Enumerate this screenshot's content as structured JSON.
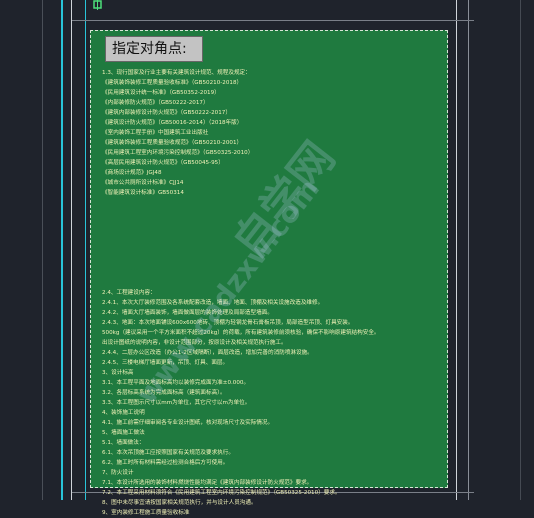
{
  "prompt": {
    "label": "指定对角点:"
  },
  "watermark": {
    "cn": "自学网",
    "url": "www.cadzxw.com"
  },
  "colors": {
    "background": "#1f232c",
    "selection_fill": "#1f7a3f",
    "text": "#f2f2b8",
    "prompt_bg": "#c3c3c3",
    "axis_cyan": "#29c4d8"
  },
  "notes_top": [
    "1.3、现行国家及行业主要有关建筑设计规范、规程及规定：",
    "《建筑装饰装修工程质量验收标准》（GB50210-2018）",
    "《民用建筑设计统一标准》（GB50352-2019）",
    "《内部装修防火规范》（GB50222-2017）",
    "《建筑内部装修设计防火规范》（GB50222-2017）",
    "《建筑设计防火规范》（GB50016-2014）（2018年版）",
    "《室内装饰工程手册》中国建筑工业出版社",
    "《建筑装饰装修工程质量验收规范》（GB50210-2001）",
    "《民用建筑工程室内环境污染控制规范》（GB50325-2010）",
    "《高层民用建筑设计防火规范》（GB50045-95）",
    "《商场设计规范》JGJ48",
    "《城市公共厕所设计标准》CJJ14",
    "《智能建筑设计标准》GB50314"
  ],
  "notes_bottom": [
    "2.4、工程建设内容：",
    "2.4.1、本次大厅装修范围及各系统配套改造，墙面、地面、顶棚及相关设施改造及维修。",
    "2.4.2、墙面大厅墙面装饰，墙面做面层的装饰处理及局部造型墙面。",
    "2.4.3、地面：本次地面铺设600x600地砖、顶棚为轻钢龙骨石膏板吊顶，局部造型吊顶、灯具安装。",
    "500kg（建议采用一个平方米面积不超过20kg）的荷载，所有建筑装修前须核验，确保不影响原建筑结构安全。",
    "出设计图纸的说明内容，非设计范围部分，按原设计及相关规范执行施工。",
    "2.4.4、二层办公区改造（办公1-2区域隔断），面层改造，增加完善的消防喷淋设施。",
    "2.4.5、三楼电梯厅墙面更新，吊顶、灯具、面层。",
    "3、设计标高",
    "3.1、本工程平面及地面标高均以装修完成面为准±0.000。",
    "3.2、各层标高系统为完成面标高（建筑面标高）。",
    "3.3、本工程图示尺寸以mm为单位，其它尺寸以m为单位。",
    "4、装饰施工说明",
    "4.1、施工前需仔细审阅各专业设计图纸，核对现场尺寸及实际情况。",
    "5、墙面施工做法",
    "5.1、墙面做法：",
    "6.1、本次吊顶施工应按照国家有关规范及要求执行。",
    "6.2、施工时所有材料需经过检测合格后方可使用。",
    "7、防火设计",
    "7.1、本设计所选用的装饰材料燃烧性能均满足《建筑内部装修设计防火规范》要求。",
    "7.2、本工程采用材料须符合《民用建筑工程室内环境污染控制规范》（GB50325-2010）要求。",
    "8、图中未尽事宜请按国家相关规范执行，并与设计人员沟通。",
    "9、室内装修工程施工质量验收标准"
  ]
}
